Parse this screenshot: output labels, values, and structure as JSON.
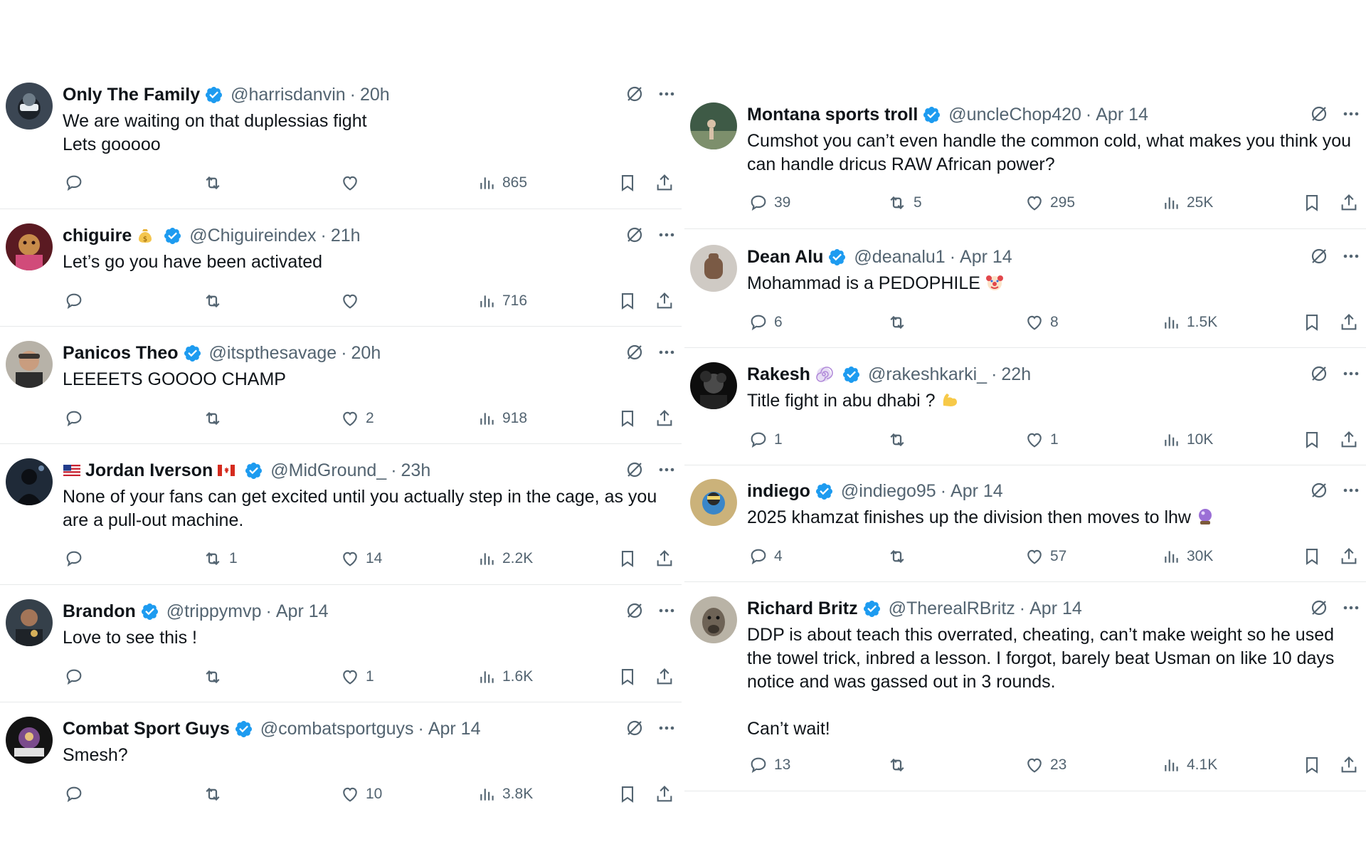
{
  "colors": {
    "verified": "#1d9bf0",
    "text": "#0f1419",
    "muted": "#536471",
    "divider": "#e7e9ea"
  },
  "left_column": {
    "tweets": [
      {
        "name": "Only The Family",
        "handle": "@harrisdanvin",
        "time": "20h",
        "text": [
          "We are waiting on that duplessias fight",
          "Lets gooooo"
        ],
        "replies": "",
        "retweets": "",
        "likes": "",
        "views": "865"
      },
      {
        "name": "chiguire",
        "name_emoji": "money-bag-icon",
        "handle": "@Chiguireindex",
        "time": "21h",
        "text": [
          "Let’s go you have been activated"
        ],
        "replies": "",
        "retweets": "",
        "likes": "",
        "views": "716"
      },
      {
        "name": "Panicos Theo",
        "handle": "@itspthesavage",
        "time": "20h",
        "text": [
          "LEEEETS GOOOO CHAMP"
        ],
        "replies": "",
        "retweets": "",
        "likes": "2",
        "views": "918"
      },
      {
        "name": "Jordan Iverson",
        "name_emoji_before": "us-flag-icon",
        "name_emoji": "canada-flag-icon",
        "handle": "@MidGround_",
        "time": "23h",
        "text": [
          "None of your fans can get excited until you actually step in the cage, as you are a pull-out machine."
        ],
        "replies": "",
        "retweets": "1",
        "likes": "14",
        "views": "2.2K"
      },
      {
        "name": "Brandon",
        "handle": "@trippymvp",
        "time": "Apr 14",
        "text": [
          "Love to see this !"
        ],
        "replies": "",
        "retweets": "",
        "likes": "1",
        "views": "1.6K"
      },
      {
        "name": "Combat Sport Guys",
        "handle": "@combatsportguys",
        "time": "Apr 14",
        "text": [
          "Smesh?"
        ],
        "replies": "",
        "retweets": "",
        "likes": "10",
        "views": "3.8K"
      }
    ]
  },
  "right_column": {
    "tweets": [
      {
        "name": "Montana sports troll",
        "handle": "@uncleChop420",
        "time": "Apr 14",
        "text": [
          "Cumshot you can’t even handle the common cold, what makes you think you can handle dricus RAW African power?"
        ],
        "replies": "39",
        "retweets": "5",
        "likes": "295",
        "views": "25K"
      },
      {
        "name": "Dean Alu",
        "handle": "@deanalu1",
        "time": "Apr 14",
        "text": [
          "Mohammad is a PEDOPHILE"
        ],
        "text_emoji": "clown-face-icon",
        "replies": "6",
        "retweets": "",
        "likes": "8",
        "views": "1.5K"
      },
      {
        "name": "Rakesh",
        "name_emoji": "spiral-icon",
        "handle": "@rakeshkarki_",
        "time": "22h",
        "text": [
          "Title fight in abu dhabi ?"
        ],
        "text_emoji": "flexed-biceps-icon",
        "replies": "1",
        "retweets": "",
        "likes": "1",
        "views": "10K"
      },
      {
        "name": "indiego",
        "handle": "@indiego95",
        "time": "Apr 14",
        "text": [
          "2025 khamzat finishes up the division then moves to lhw"
        ],
        "text_emoji": "crystal-ball-icon",
        "replies": "4",
        "retweets": "",
        "likes": "57",
        "views": "30K"
      },
      {
        "name": "Richard Britz",
        "handle": "@TherealRBritz",
        "time": "Apr 14",
        "text": [
          "DDP is about teach this overrated, cheating, can’t make weight so he used the towel trick, inbred a lesson. I forgot, barely beat Usman on like 10 days notice and was gassed out in 3 rounds.",
          "",
          "Can’t wait!"
        ],
        "replies": "13",
        "retweets": "",
        "likes": "23",
        "views": "4.1K"
      }
    ]
  }
}
